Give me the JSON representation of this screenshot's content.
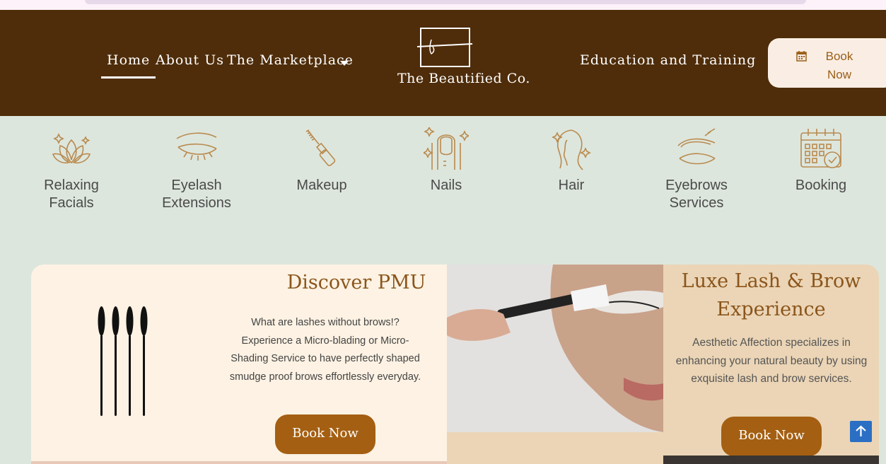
{
  "nav": {
    "items": [
      {
        "label": "Home",
        "active": true
      },
      {
        "label": "About Us"
      },
      {
        "label": "The Marketplace"
      },
      {
        "label": "Education and Training"
      }
    ],
    "logo_text": "The Beautified Co.",
    "logo_mark": "b",
    "book_label_line1": "Book",
    "book_label_line2": "Now"
  },
  "services": [
    {
      "line1": "Relaxing",
      "line2": "Facials",
      "icon": "lotus-icon"
    },
    {
      "line1": "Eyelash",
      "line2": "Extensions",
      "icon": "eyelash-icon"
    },
    {
      "line1": "Makeup",
      "line2": "",
      "icon": "mascara-icon"
    },
    {
      "line1": "Nails",
      "line2": "",
      "icon": "nail-icon"
    },
    {
      "line1": "Hair",
      "line2": "",
      "icon": "hair-icon"
    },
    {
      "line1": "Eyebrows",
      "line2": "Services",
      "icon": "eyebrow-icon"
    },
    {
      "line1": "Booking",
      "line2": "",
      "icon": "calendar-check-icon"
    }
  ],
  "pmu": {
    "title": "Discover PMU",
    "text": "What are lashes without brows!? Experience a Micro-blading or Micro-Shading Service to have perfectly shaped smudge proof brows effortlessly everyday.",
    "button": "Book Now"
  },
  "luxe": {
    "title_line1": "Luxe Lash & Brow",
    "title_line2": "Experience",
    "text": "Aesthetic Affection specializes in enhancing your natural beauty by using exquisite lash and brow services.",
    "button": "Book Now"
  },
  "colors": {
    "brand_brown": "#4f2d0a",
    "accent": "#a45f12",
    "page_bg": "#dde6dd"
  }
}
